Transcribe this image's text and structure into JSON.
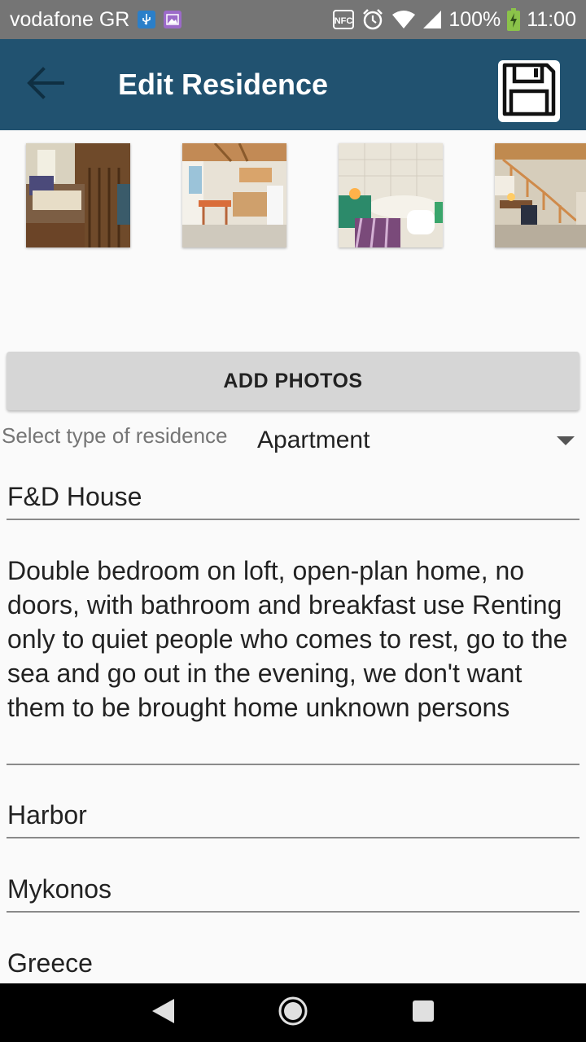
{
  "status_bar": {
    "carrier": "vodafone GR",
    "usb_icon": "usb-icon",
    "gallery_icon": "image-icon",
    "nfc_label": "NFC",
    "alarm_icon": "alarm-icon",
    "wifi_icon": "wifi-icon",
    "signal_icon": "signal-icon",
    "battery_percent": "100%",
    "battery_icon": "battery-charging-icon",
    "time": "11:00"
  },
  "app_bar": {
    "title": "Edit Residence",
    "back_icon": "arrow-back-icon",
    "save_icon": "floppy-disk-icon",
    "background": "#215270"
  },
  "photos": [
    {
      "subject": "bedroom"
    },
    {
      "subject": "kitchen"
    },
    {
      "subject": "bathroom"
    },
    {
      "subject": "loft-living-room"
    }
  ],
  "add_photos_label": "ADD PHOTOS",
  "residence_type": {
    "label": "Select type of residence",
    "value": "Apartment"
  },
  "form": {
    "name": "F&D House",
    "description": "Double bedroom on loft, open-plan home, no doors, with bathroom and breakfast use Renting only to quiet people who comes to rest, go to the sea and go out in the evening, we don't want them to be brought home unknown persons",
    "area": "Harbor",
    "city": "Mykonos",
    "country": "Greece"
  },
  "nav_bar": {
    "back_icon": "nav-back-icon",
    "home_icon": "nav-home-icon",
    "recents_icon": "nav-recents-icon"
  }
}
